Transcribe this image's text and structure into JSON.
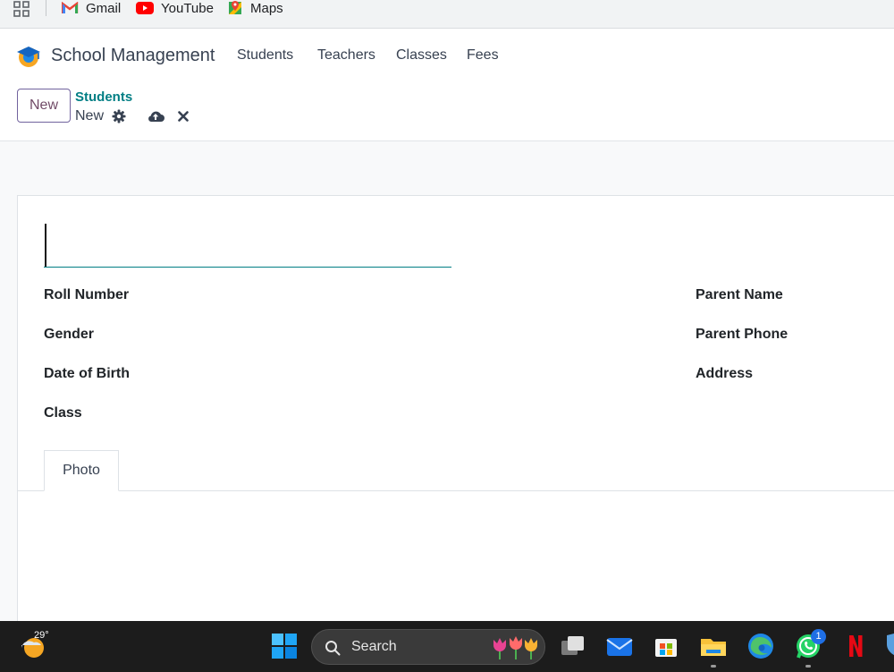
{
  "bookmarks": {
    "items": [
      {
        "label": "Gmail",
        "icon": "gmail-icon"
      },
      {
        "label": "YouTube",
        "icon": "youtube-icon"
      },
      {
        "label": "Maps",
        "icon": "maps-icon"
      }
    ]
  },
  "app": {
    "brand": "School Management",
    "menu": [
      "Students",
      "Teachers",
      "Classes",
      "Fees"
    ],
    "accent_color": "#017e84",
    "brand_color": "#714b67"
  },
  "control_panel": {
    "new_button": "New",
    "breadcrumb_parent": "Students",
    "breadcrumb_current": "New",
    "icons": [
      "gear-icon",
      "cloud-upload-icon",
      "close-icon"
    ]
  },
  "form": {
    "name_value": "",
    "left_labels": [
      "Roll Number",
      "Gender",
      "Date of Birth",
      "Class"
    ],
    "right_labels": [
      "Parent Name",
      "Parent Phone",
      "Address"
    ],
    "tabs": [
      "Photo"
    ]
  },
  "taskbar": {
    "weather_temp": "29°",
    "search_label": "Search",
    "whatsapp_badge": "1",
    "icons": [
      "windows-start-icon",
      "task-view-icon",
      "mail-icon",
      "store-icon",
      "file-explorer-icon",
      "edge-icon",
      "whatsapp-icon",
      "netflix-icon"
    ]
  }
}
